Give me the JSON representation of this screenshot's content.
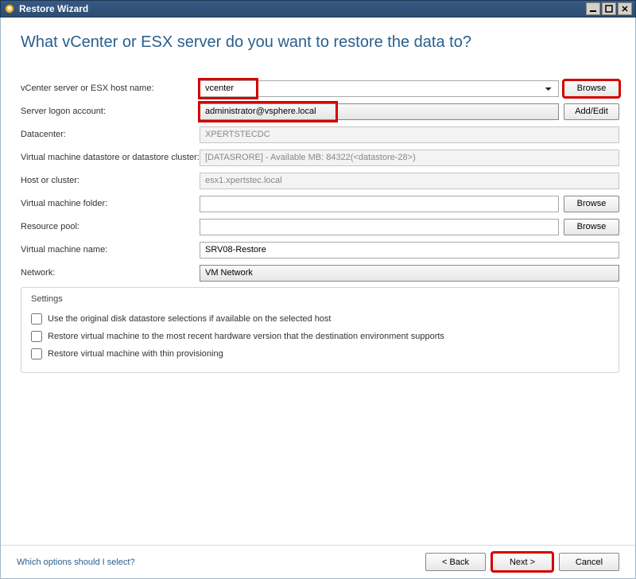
{
  "window": {
    "title": "Restore Wizard"
  },
  "heading": "What vCenter or ESX server do you want to restore the data to?",
  "fields": {
    "vcenter": {
      "label": "vCenter server or ESX host name:",
      "value": "vcenter",
      "browse": "Browse"
    },
    "logon": {
      "label": "Server logon account:",
      "value": "administrator@vsphere.local",
      "addedit": "Add/Edit"
    },
    "datacenter": {
      "label": "Datacenter:",
      "value": "XPERTSTECDC"
    },
    "datastore": {
      "label": "Virtual machine datastore or datastore cluster:",
      "value": "[DATASRORE] - Available MB: 84322(<datastore-28>)"
    },
    "host": {
      "label": "Host or cluster:",
      "value": "esx1.xpertstec.local"
    },
    "folder": {
      "label": "Virtual machine folder:",
      "value": "",
      "browse": "Browse"
    },
    "pool": {
      "label": "Resource pool:",
      "value": "",
      "browse": "Browse"
    },
    "vmname": {
      "label": "Virtual machine name:",
      "value": "SRV08-Restore"
    },
    "network": {
      "label": "Network:",
      "value": "VM Network"
    }
  },
  "settings": {
    "legend": "Settings",
    "opt1": "Use the original disk datastore selections if available on the selected host",
    "opt2": "Restore virtual machine to the most recent hardware version that the destination environment supports",
    "opt3": "Restore virtual machine with thin provisioning"
  },
  "footer": {
    "help": "Which options should I select?",
    "back": "< Back",
    "next": "Next >",
    "cancel": "Cancel"
  }
}
